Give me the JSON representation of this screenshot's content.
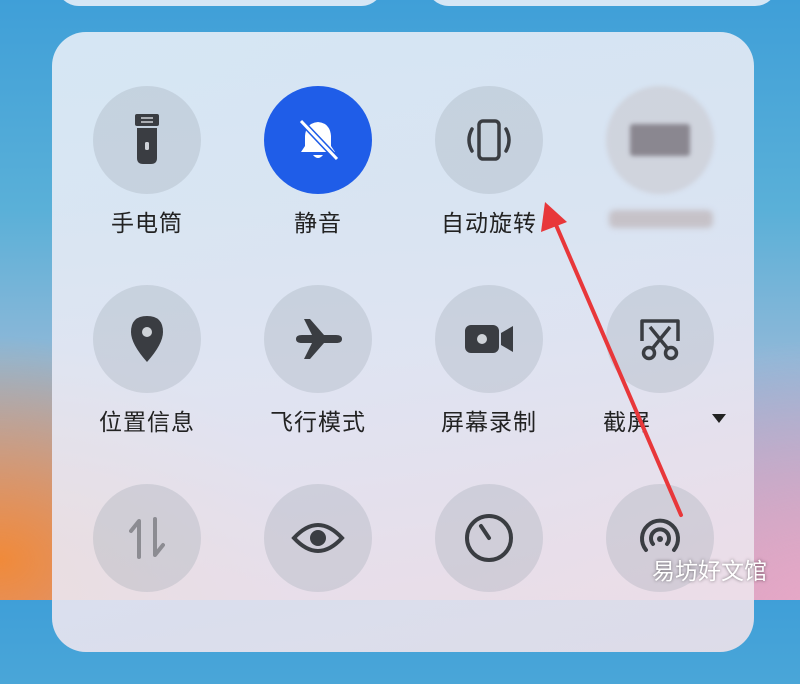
{
  "tiles": [
    {
      "name": "flashlight",
      "label": "手电筒",
      "icon": "flashlight-icon",
      "active": false
    },
    {
      "name": "silent",
      "label": "静音",
      "icon": "bell-off-icon",
      "active": true
    },
    {
      "name": "auto-rotate",
      "label": "自动旋转",
      "icon": "rotate-icon",
      "active": false
    },
    {
      "name": "blurred",
      "label": "",
      "icon": "blurred-icon",
      "active": false
    },
    {
      "name": "location",
      "label": "位置信息",
      "icon": "location-pin-icon",
      "active": false
    },
    {
      "name": "airplane-mode",
      "label": "飞行模式",
      "icon": "airplane-icon",
      "active": false
    },
    {
      "name": "screen-record",
      "label": "屏幕录制",
      "icon": "video-camera-icon",
      "active": false
    },
    {
      "name": "screenshot",
      "label": "截屏",
      "icon": "scissors-icon",
      "active": false
    },
    {
      "name": "mobile-data",
      "label": "",
      "icon": "data-arrows-icon",
      "active": false
    },
    {
      "name": "eye-comfort",
      "label": "",
      "icon": "eye-icon",
      "active": false
    },
    {
      "name": "timer",
      "label": "",
      "icon": "timer-icon",
      "active": false
    },
    {
      "name": "hotspot",
      "label": "",
      "icon": "hotspot-icon",
      "active": false
    }
  ],
  "watermark": "易坊好文馆",
  "colors": {
    "active": "#1f5de8",
    "arrow": "#e8373a"
  }
}
